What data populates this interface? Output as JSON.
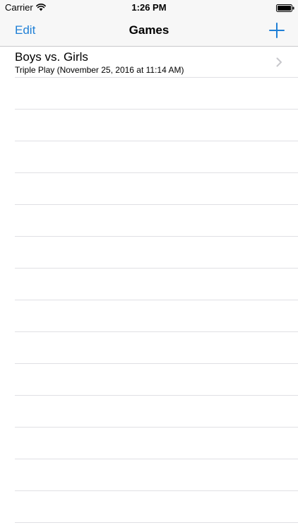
{
  "status_bar": {
    "carrier": "Carrier",
    "time": "1:26 PM"
  },
  "nav": {
    "edit_label": "Edit",
    "title": "Games",
    "add_icon": "plus-icon"
  },
  "games": [
    {
      "title": "Boys vs. Girls",
      "subtitle": "Triple Play (November 25, 2016 at 11:14 AM)"
    }
  ],
  "colors": {
    "tint": "#1e7fd6",
    "separator": "#e0e0e4",
    "nav_background": "#f7f7f7"
  }
}
